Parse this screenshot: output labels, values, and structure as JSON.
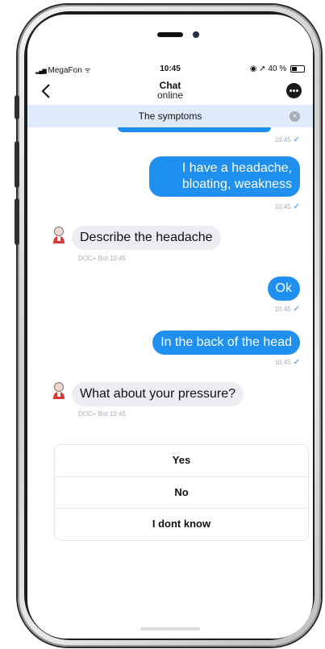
{
  "status_bar": {
    "carrier": "MegaFon",
    "time": "10:45",
    "battery": "40 %"
  },
  "nav": {
    "title": "Chat",
    "subtitle": "online"
  },
  "topic": {
    "label": "The symptoms"
  },
  "messages": [
    {
      "direction": "out",
      "text": "",
      "time": "10:45"
    },
    {
      "direction": "out",
      "text": "I have a headache, bloating, weakness",
      "time": "10:45"
    },
    {
      "direction": "in",
      "sender": "DOC+ Bot",
      "text": "Describe the headache",
      "time": "10:45"
    },
    {
      "direction": "out",
      "text": "Ok",
      "time": "10:45"
    },
    {
      "direction": "out",
      "text": "In the back of the head",
      "time": "10:45"
    },
    {
      "direction": "in",
      "sender": "DOC+ Bot",
      "text": "What about your pressure?",
      "time": "10:45"
    }
  ],
  "options": [
    {
      "label": "Yes"
    },
    {
      "label": "No"
    },
    {
      "label": "I dont know"
    }
  ],
  "colors": {
    "outgoing_bubble": "#1f8ff0",
    "incoming_bubble": "#edeef1",
    "topic_banner": "#dfeafb",
    "read_check": "#2a8ce8"
  },
  "icons": {
    "back": "chevron-left-icon",
    "more": "more-icon",
    "close": "close-icon",
    "bot": "doctor-bot-icon",
    "read": "check-icon"
  }
}
